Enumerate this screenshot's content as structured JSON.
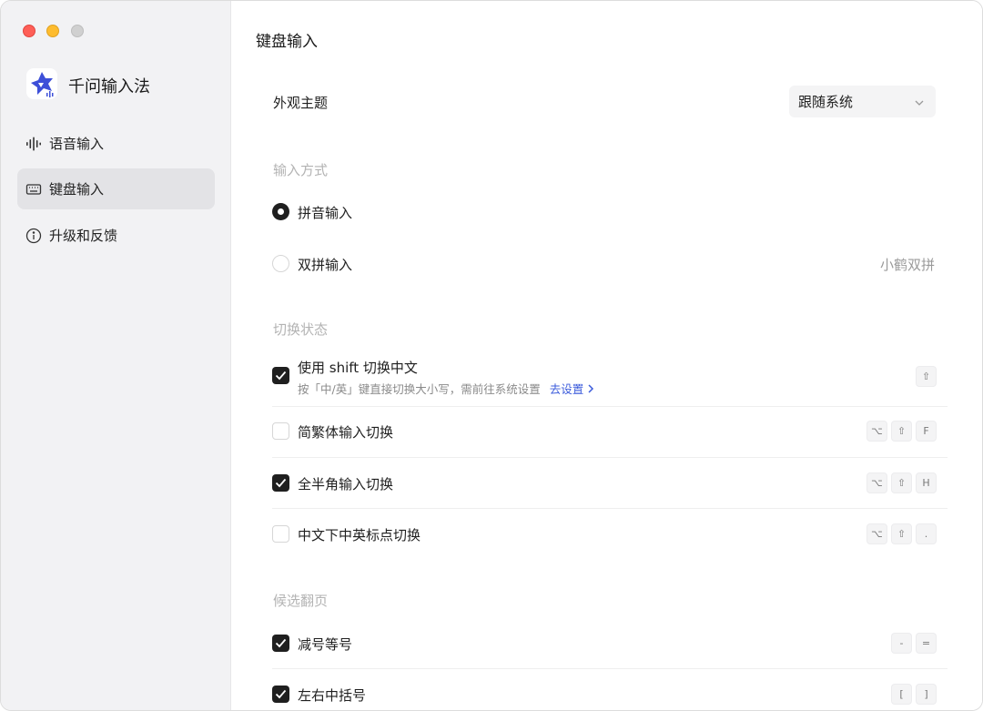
{
  "app": {
    "name": "千问输入法",
    "logo_icon": "qianwen-logo-icon"
  },
  "sidebar": {
    "items": [
      {
        "label": "语音输入",
        "icon": "voice-waveform-icon",
        "active": false
      },
      {
        "label": "键盘输入",
        "icon": "keyboard-icon",
        "active": true
      },
      {
        "label": "升级和反馈",
        "icon": "info-icon",
        "active": false
      }
    ]
  },
  "main": {
    "title": "键盘输入",
    "theme": {
      "label": "外观主题",
      "value": "跟随系统"
    },
    "input_method": {
      "section_title": "输入方式",
      "options": [
        {
          "label": "拼音输入",
          "selected": true
        },
        {
          "label": "双拼输入",
          "selected": false,
          "detail": "小鹤双拼"
        }
      ]
    },
    "switch_state": {
      "section_title": "切换状态",
      "items": [
        {
          "label": "使用 shift 切换中文",
          "checked": true,
          "desc": "按「中/英」键直接切换大小写，需前往系统设置",
          "link": "去设置",
          "keys": [
            "⇧"
          ]
        },
        {
          "label": "简繁体输入切换",
          "checked": false,
          "keys": [
            "⌥",
            "⇧",
            "F"
          ]
        },
        {
          "label": "全半角输入切换",
          "checked": true,
          "keys": [
            "⌥",
            "⇧",
            "H"
          ]
        },
        {
          "label": "中文下中英标点切换",
          "checked": false,
          "keys": [
            "⌥",
            "⇧",
            "."
          ]
        }
      ]
    },
    "paging": {
      "section_title": "候选翻页",
      "items": [
        {
          "label": "减号等号",
          "checked": true,
          "keys": [
            "-",
            "="
          ]
        },
        {
          "label": "左右中括号",
          "checked": true,
          "keys": [
            "[",
            "]"
          ]
        }
      ]
    }
  },
  "colors": {
    "accent": "#3b5bdb",
    "checked": "#1f1f1f",
    "sidebar_bg": "#f2f2f4"
  }
}
